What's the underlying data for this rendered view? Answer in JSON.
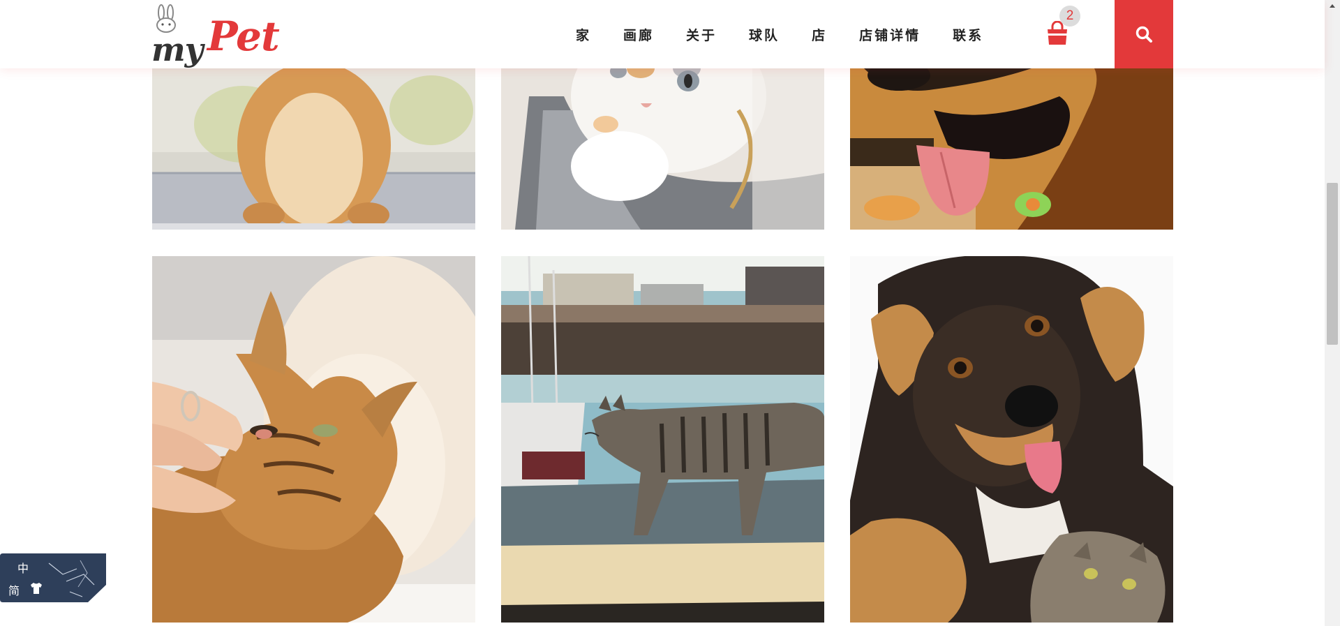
{
  "header": {
    "logo": {
      "word_my": "my",
      "word_pet": "Pet"
    },
    "nav": [
      {
        "label": "家"
      },
      {
        "label": "画廊"
      },
      {
        "label": "关于"
      },
      {
        "label": "球队"
      },
      {
        "label": "店"
      },
      {
        "label": "店铺详情"
      },
      {
        "label": "联系"
      }
    ],
    "cart": {
      "icon": "shopping-bag-icon",
      "count": "2"
    },
    "search": {
      "icon": "search-icon"
    }
  },
  "gallery": {
    "rows": [
      {
        "tiles": [
          {
            "subject": "orange-kitten"
          },
          {
            "subject": "white-kitten"
          },
          {
            "subject": "golden-dog"
          }
        ]
      },
      {
        "tiles": [
          {
            "subject": "tabby-cat-petted"
          },
          {
            "subject": "tabby-cat-walking"
          },
          {
            "subject": "black-tan-dog-with-cat"
          }
        ]
      }
    ]
  },
  "language_widget": {
    "top_label": "中",
    "bottom_label": "简",
    "icon": "shirt-icon"
  },
  "scrollbar": {
    "position": 0.28
  },
  "colors": {
    "accent": "#e3393a",
    "text": "#222222",
    "badge_bg": "#dcdcdc",
    "widget_bg": "#2e3f5a"
  }
}
